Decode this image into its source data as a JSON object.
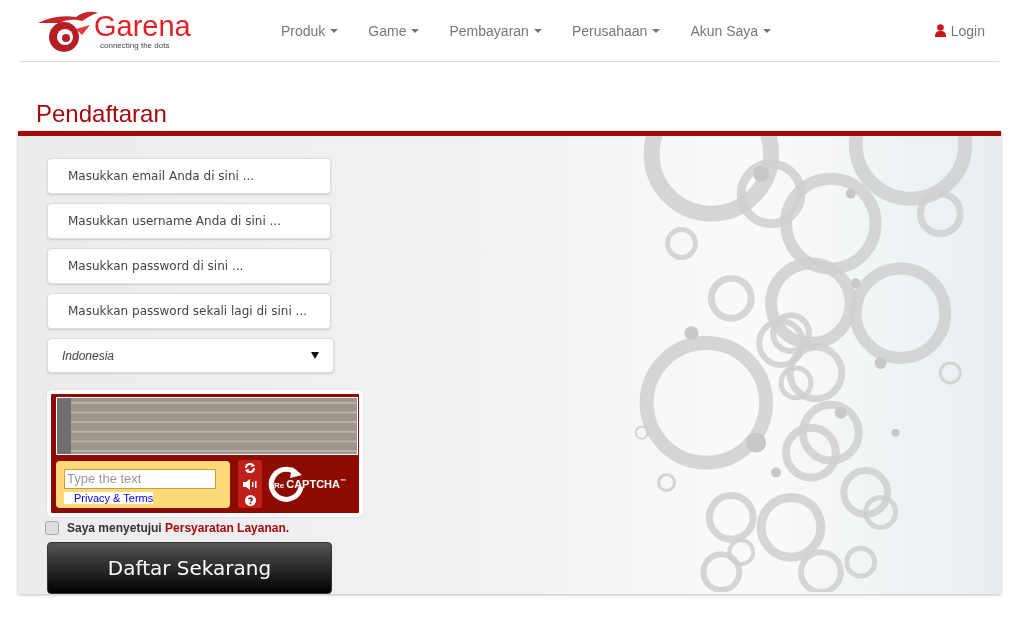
{
  "logo": {
    "name": "Garena",
    "tagline": "connecting the dots"
  },
  "nav": [
    {
      "label": "Produk",
      "dropdown": true
    },
    {
      "label": "Game",
      "dropdown": true
    },
    {
      "label": "Pembayaran",
      "dropdown": true
    },
    {
      "label": "Perusahaan",
      "dropdown": true
    },
    {
      "label": "Akun Saya",
      "dropdown": true
    }
  ],
  "login": "Login",
  "page_title": "Pendaftaran",
  "form": {
    "fields": [
      {
        "placeholder": "Masukkan email Anda di sini ..."
      },
      {
        "placeholder": "Masukkan username Anda di sini ..."
      },
      {
        "placeholder": "Masukkan password di sini ..."
      },
      {
        "placeholder": "Masukkan password sekali lagi di sini ..."
      }
    ],
    "country": {
      "value": "Indonesia"
    },
    "captcha": {
      "placeholder": "Type the text",
      "privacy_link": "Privacy & Terms",
      "brand_prefix": "Re",
      "brand": "CAPTCHA",
      "trademark": "™"
    },
    "agree": {
      "text": "Saya menyetujui",
      "link": "Persyaratan Layanan.",
      "checked": false
    },
    "submit": "Daftar Sekarang"
  }
}
